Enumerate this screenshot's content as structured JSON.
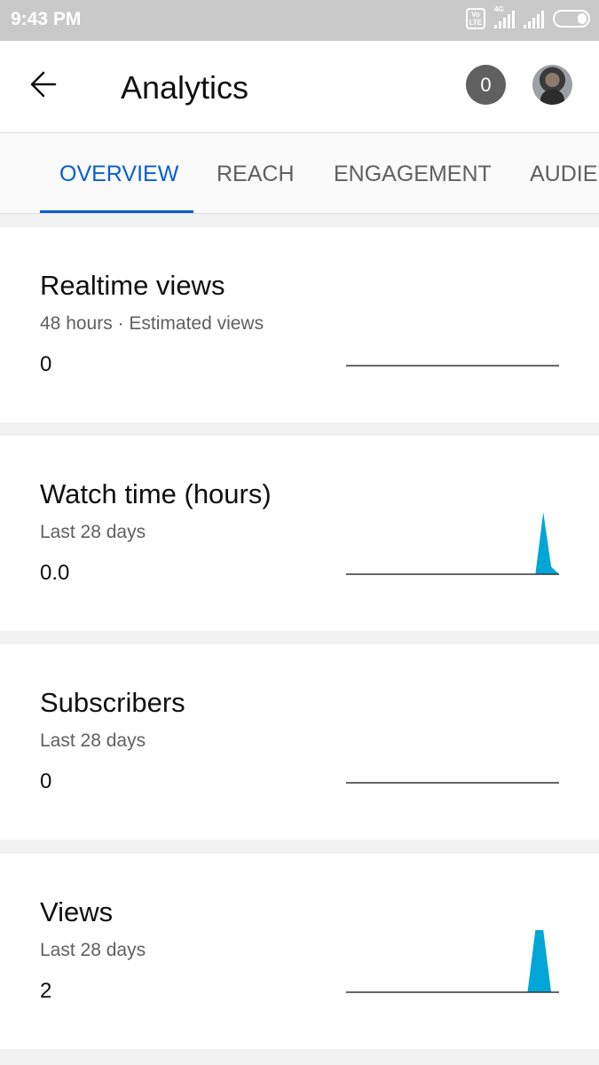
{
  "status_bar": {
    "time": "9:43 PM",
    "volte_top": "Vo",
    "volte_bottom": "LTE",
    "network": "4G",
    "icons": [
      "volte-icon",
      "signal-icon",
      "signal-icon",
      "battery-icon"
    ]
  },
  "header": {
    "back_icon": "arrow-left-icon",
    "title": "Analytics",
    "notification_count": "0"
  },
  "tabs": [
    {
      "label": "OVERVIEW",
      "active": true
    },
    {
      "label": "REACH",
      "active": false
    },
    {
      "label": "ENGAGEMENT",
      "active": false
    },
    {
      "label": "AUDIENCE",
      "active": false
    }
  ],
  "cards": [
    {
      "title": "Realtime views",
      "subtitle": "48 hours · Estimated views",
      "value": "0",
      "sparkline": {
        "type": "area",
        "values": [
          0,
          0,
          0,
          0,
          0,
          0,
          0,
          0,
          0,
          0,
          0,
          0,
          0,
          0,
          0,
          0,
          0,
          0,
          0,
          0,
          0,
          0,
          0,
          0,
          0,
          0,
          0,
          0
        ]
      }
    },
    {
      "title": "Watch time (hours)",
      "subtitle": "Last 28 days",
      "value": "0.0",
      "sparkline": {
        "type": "area",
        "values": [
          0,
          0,
          0,
          0,
          0,
          0,
          0,
          0,
          0,
          0,
          0,
          0,
          0,
          0,
          0,
          0,
          0,
          0,
          0,
          0,
          0,
          0,
          0,
          0,
          0,
          1,
          0.12,
          0
        ]
      }
    },
    {
      "title": "Subscribers",
      "subtitle": "Last 28 days",
      "value": "0",
      "sparkline": {
        "type": "area",
        "values": [
          0,
          0,
          0,
          0,
          0,
          0,
          0,
          0,
          0,
          0,
          0,
          0,
          0,
          0,
          0,
          0,
          0,
          0,
          0,
          0,
          0,
          0,
          0,
          0,
          0,
          0,
          0,
          0
        ]
      }
    },
    {
      "title": "Views",
      "subtitle": "Last 28 days",
      "value": "2",
      "sparkline": {
        "type": "area",
        "values": [
          0,
          0,
          0,
          0,
          0,
          0,
          0,
          0,
          0,
          0,
          0,
          0,
          0,
          0,
          0,
          0,
          0,
          0,
          0,
          0,
          0,
          0,
          0,
          0,
          1,
          1,
          0,
          0
        ]
      }
    }
  ],
  "colors": {
    "accent": "#065fd4",
    "sparkline_fill": "#00a6d6",
    "baseline": "#333333",
    "badge": "#606060"
  }
}
